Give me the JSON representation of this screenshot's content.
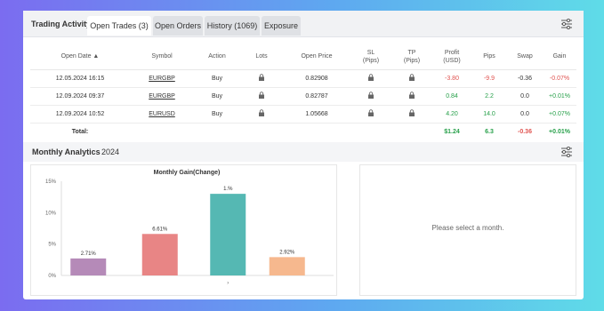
{
  "header": {
    "title": "Trading Activity",
    "tabs": [
      {
        "label": "Open Trades (3)",
        "active": true
      },
      {
        "label": "Open Orders",
        "active": false
      },
      {
        "label": "History (1069)",
        "active": false
      },
      {
        "label": "Exposure",
        "active": false
      }
    ],
    "settings_icon": "sliders-icon"
  },
  "table": {
    "columns": [
      "Open Date ▲",
      "Symbol",
      "Action",
      "Lots",
      "Open Price",
      "SL\n(Pips)",
      "TP\n(Pips)",
      "Profit\n(USD)",
      "Pips",
      "Swap",
      "Gain"
    ],
    "rows": [
      {
        "date": "12.05.2024 16:15",
        "symbol": "EURGBP",
        "action": "Buy",
        "open_price": "0.82908",
        "profit": "-3.80",
        "pips": "-9.9",
        "swap": "-0.36",
        "gain": "-0.07%",
        "profit_color": "#e0524f",
        "gain_color": "#e0524f"
      },
      {
        "date": "12.09.2024 09:37",
        "symbol": "EURGBP",
        "action": "Buy",
        "open_price": "0.82787",
        "profit": "0.84",
        "pips": "2.2",
        "swap": "0.0",
        "gain": "+0.01%",
        "profit_color": "#27a04a",
        "gain_color": "#27a04a"
      },
      {
        "date": "12.09.2024 10:52",
        "symbol": "EURUSD",
        "action": "Buy",
        "open_price": "1.05668",
        "profit": "4.20",
        "pips": "14.0",
        "swap": "0.0",
        "gain": "+0.07%",
        "profit_color": "#27a04a",
        "gain_color": "#27a04a"
      }
    ],
    "total": {
      "label": "Total:",
      "profit": "$1.24",
      "pips": "6.3",
      "swap": "-0.36",
      "gain": "+0.01%"
    }
  },
  "analytics": {
    "title": "Monthly Analytics",
    "year": "2024",
    "placeholder": "Please select a month."
  },
  "chart_data": {
    "type": "bar",
    "title": "Monthly Gain(Change)",
    "yticks": [
      "15%",
      "10%",
      "5%",
      "0%"
    ],
    "ylim": [
      0,
      15
    ],
    "categories": [
      "",
      "",
      "",
      ""
    ],
    "values": [
      2.71,
      6.61,
      13,
      2.92
    ],
    "labels": [
      "2.71%",
      "6.61%",
      "1.%",
      "2.92%"
    ],
    "colors": [
      "#b58ab8",
      "#e88585",
      "#55b8b3",
      "#f6b88e"
    ],
    "x_tick_marks": [
      "",
      "",
      "›",
      ""
    ],
    "grid": false
  }
}
